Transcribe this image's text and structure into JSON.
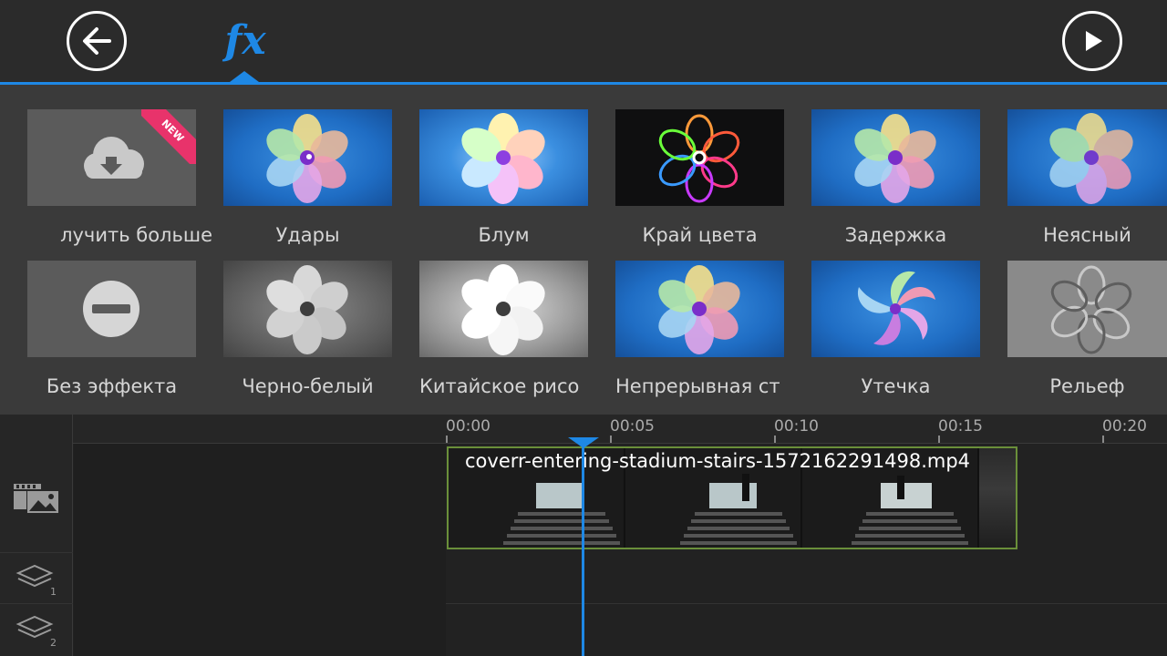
{
  "toolbar": {
    "back_icon": "arrow-left-icon",
    "fx_label": "fx",
    "play_icon": "play-icon",
    "accent_color": "#1e88e5"
  },
  "effects": {
    "row1": [
      {
        "label": "лучить больше",
        "icon": "cloud-download-icon",
        "badge": "NEW"
      },
      {
        "label": "Удары"
      },
      {
        "label": "Блум"
      },
      {
        "label": "Край цвета"
      },
      {
        "label": "Задержка"
      },
      {
        "label": "Неясный"
      }
    ],
    "row2": [
      {
        "label": "Без эффекта",
        "icon": "no-entry-icon"
      },
      {
        "label": "Черно-белый"
      },
      {
        "label": "Китайское рисо"
      },
      {
        "label": "Непрерывная ст"
      },
      {
        "label": "Утечка"
      },
      {
        "label": "Рельеф"
      }
    ]
  },
  "timeline": {
    "ticks": [
      "00:00",
      "00:05",
      "00:10",
      "00:15",
      "00:20"
    ],
    "tracks": [
      {
        "icon": "video-image-track-icon"
      },
      {
        "icon": "layers-icon",
        "index": "1"
      },
      {
        "icon": "layers-icon",
        "index": "2"
      }
    ],
    "clip": {
      "title": "coverr-entering-stadium-stairs-1572162291498.mp4"
    }
  }
}
